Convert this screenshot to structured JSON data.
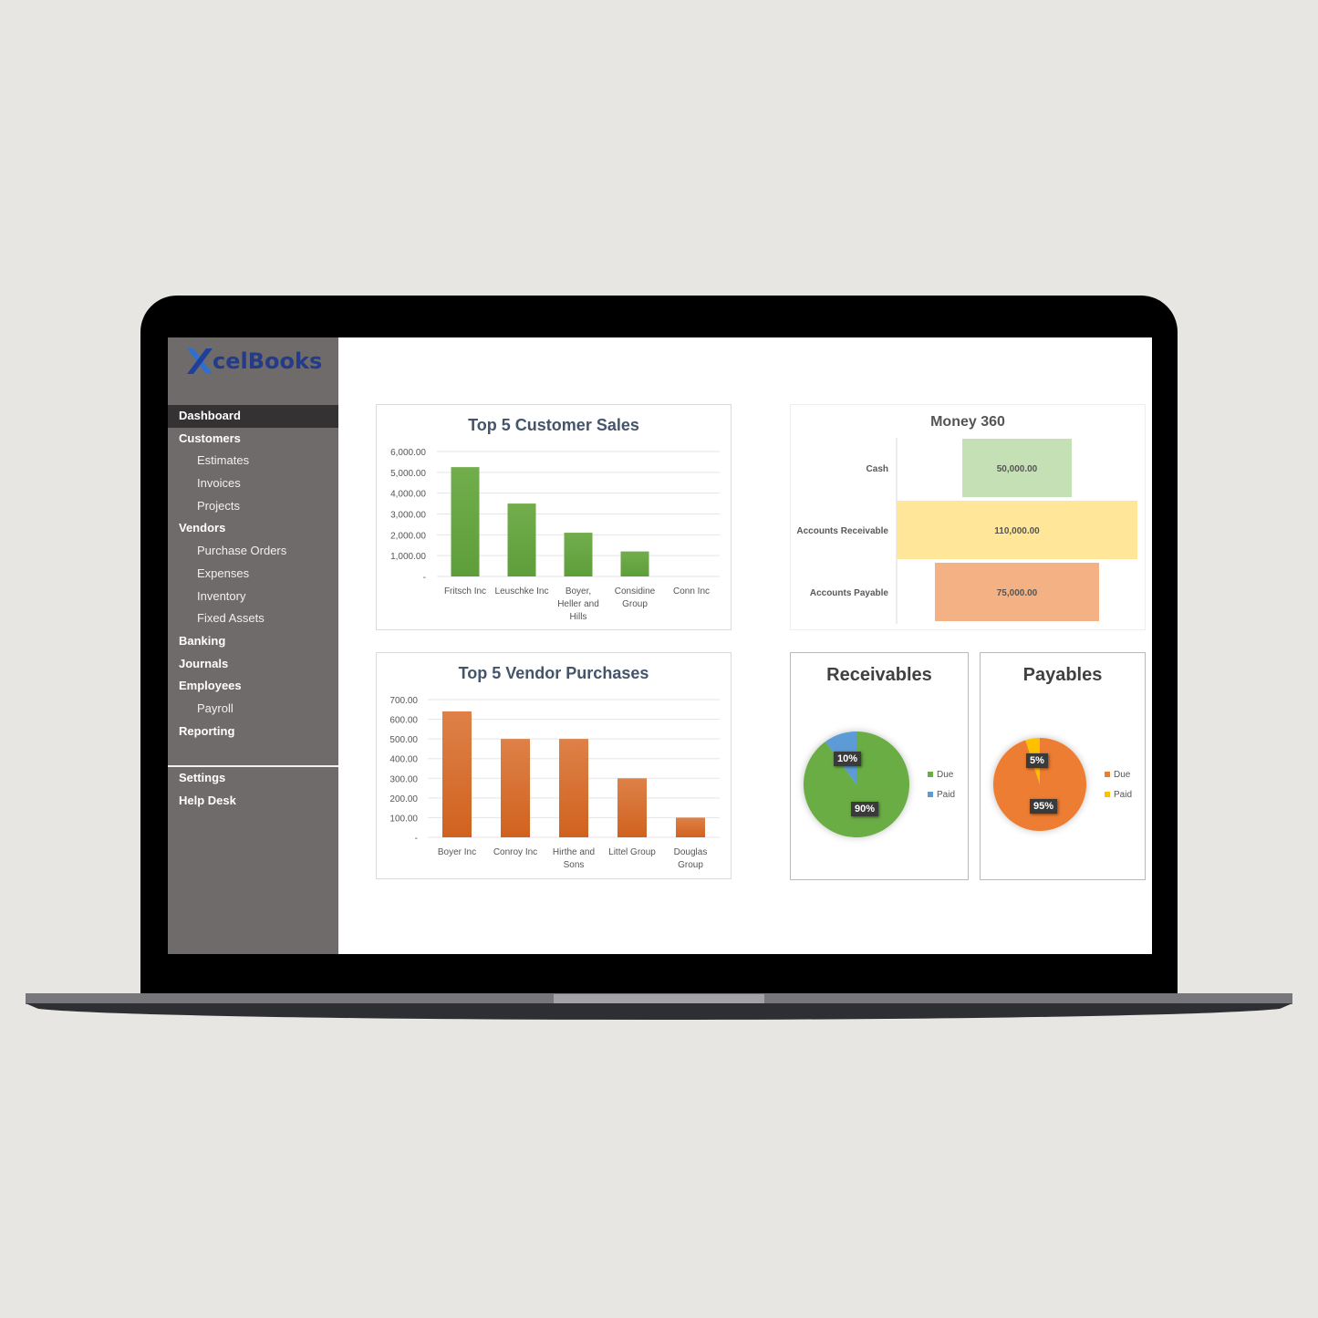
{
  "app": {
    "logo_text": "celBooks",
    "logo_letter": "X",
    "brand_color": "#243b8a",
    "logo_x_color": "#2f6fd0"
  },
  "sidebar": {
    "items": [
      {
        "label": "Dashboard",
        "level": "main",
        "active": true
      },
      {
        "label": "Customers",
        "level": "main"
      },
      {
        "label": "Estimates",
        "level": "sub"
      },
      {
        "label": "Invoices",
        "level": "sub"
      },
      {
        "label": "Projects",
        "level": "sub"
      },
      {
        "label": "Vendors",
        "level": "main"
      },
      {
        "label": "Purchase Orders",
        "level": "sub"
      },
      {
        "label": "Expenses",
        "level": "sub"
      },
      {
        "label": "Inventory",
        "level": "sub"
      },
      {
        "label": "Fixed Assets",
        "level": "sub"
      },
      {
        "label": "Banking",
        "level": "main"
      },
      {
        "label": "Journals",
        "level": "main"
      },
      {
        "label": "Employees",
        "level": "main"
      },
      {
        "label": "Payroll",
        "level": "sub"
      },
      {
        "label": "Reporting",
        "level": "main"
      }
    ],
    "footer_items": [
      {
        "label": "Settings"
      },
      {
        "label": "Help Desk"
      }
    ]
  },
  "chart_data": [
    {
      "id": "customer_sales",
      "type": "bar",
      "title": "Top 5 Customer Sales",
      "categories": [
        "Fritsch Inc",
        "Leuschke Inc",
        "Boyer, Heller and Hills",
        "Considine Group",
        "Conn Inc"
      ],
      "category_lines": [
        [
          "Fritsch Inc"
        ],
        [
          "Leuschke Inc"
        ],
        [
          "Boyer,",
          "Heller and",
          "Hills"
        ],
        [
          "Considine",
          "Group"
        ],
        [
          "Conn Inc"
        ]
      ],
      "values": [
        5250,
        3500,
        2100,
        1200,
        0
      ],
      "ylim": [
        0,
        6000
      ],
      "yticks": [
        0,
        1000,
        2000,
        3000,
        4000,
        5000,
        6000
      ],
      "ytick_labels": [
        "-",
        "1,000.00",
        "2,000.00",
        "3,000.00",
        "4,000.00",
        "5,000.00",
        "6,000.00"
      ],
      "color": "#5e9e3a",
      "color_light": "#72ad4c",
      "grid": true,
      "xlabel": "",
      "ylabel": ""
    },
    {
      "id": "vendor_purchases",
      "type": "bar",
      "title": "Top 5 Vendor Purchases",
      "categories": [
        "Boyer Inc",
        "Conroy Inc",
        "Hirthe and Sons",
        "Littel Group",
        "Douglas Group"
      ],
      "category_lines": [
        [
          "Boyer Inc"
        ],
        [
          "Conroy Inc"
        ],
        [
          "Hirthe and",
          "Sons"
        ],
        [
          "Littel Group"
        ],
        [
          "Douglas",
          "Group"
        ]
      ],
      "values": [
        640,
        500,
        500,
        300,
        100
      ],
      "ylim": [
        0,
        700
      ],
      "yticks": [
        0,
        100,
        200,
        300,
        400,
        500,
        600,
        700
      ],
      "ytick_labels": [
        "-",
        "100.00",
        "200.00",
        "300.00",
        "400.00",
        "500.00",
        "600.00",
        "700.00"
      ],
      "color": "#d0621f",
      "color_light": "#de8148",
      "grid": true,
      "xlabel": "",
      "ylabel": ""
    },
    {
      "id": "money_360",
      "type": "bar",
      "orientation": "horizontal-funnel",
      "title": "Money 360",
      "categories": [
        "Cash",
        "Accounts Receivable",
        "Accounts Payable"
      ],
      "values": [
        50000,
        110000,
        75000
      ],
      "value_labels": [
        "50,000.00",
        "110,000.00",
        "75,000.00"
      ],
      "colors": [
        "#c5e0b4",
        "#ffe699",
        "#f4b183"
      ],
      "xlim": [
        0,
        110000
      ]
    },
    {
      "id": "receivables",
      "type": "pie",
      "title": "Receivables",
      "labels": [
        "Due",
        "Paid"
      ],
      "values": [
        90,
        10
      ],
      "value_labels": [
        "90%",
        "10%"
      ],
      "colors": [
        "#6aad45",
        "#5b9bd5"
      ],
      "legend": "right"
    },
    {
      "id": "payables",
      "type": "pie",
      "title": "Payables",
      "labels": [
        "Due",
        "Paid"
      ],
      "values": [
        95,
        5
      ],
      "value_labels": [
        "95%",
        "5%"
      ],
      "colors": [
        "#ed7d31",
        "#ffc000"
      ],
      "legend": "right"
    }
  ]
}
